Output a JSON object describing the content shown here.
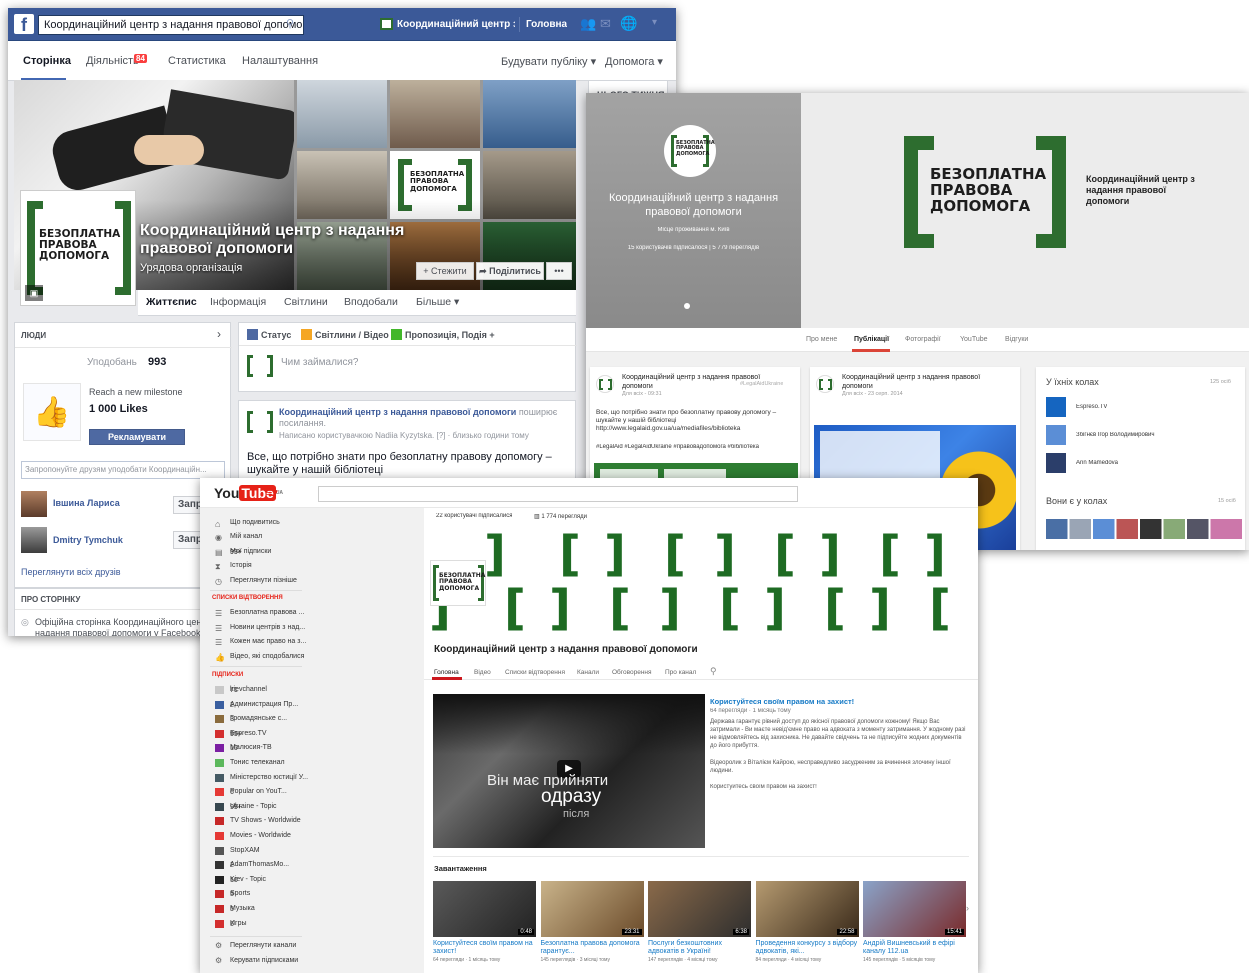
{
  "colors": {
    "fb_blue": "#3b5998",
    "brand_green": "#2d6d2f",
    "yt_red": "#e62117",
    "gp_link": "#4285f4"
  },
  "brand": {
    "logo_text": "БЕЗОПЛАТНА ПРАВОВА ДОПОМОГА"
  },
  "facebook": {
    "search_value": "Координаційний центр з надання правової допомоги",
    "top_page_name": "Координаційний центр з на...",
    "top_home": "Головна",
    "admin_tabs": [
      "Сторінка",
      "Діяльність",
      "Статистика",
      "Налаштування"
    ],
    "activity_badge": "84",
    "build_audience": "Будувати публіку ▾",
    "help": "Допомога ▾",
    "this_week": "ЦЬОГО ТИЖНЯ",
    "page_title": "Координаційний центр з надання правової допомоги",
    "page_category": "Урядова організація",
    "follow_btn": "+ Стежити",
    "share_btn": "Поділитись",
    "more_dots": "•••",
    "tabs": [
      "Життєпис",
      "Інформація",
      "Світлини",
      "Вподобали",
      "Більше ▾"
    ],
    "people_header": "ЛЮДИ",
    "likes_label": "Уподобань",
    "likes_count": "993",
    "milestone_caption": "Reach a new milestone",
    "milestone_value": "1 000 Likes",
    "promote_btn": "Рекламувати сторінку",
    "invite_placeholder": "Запропонуйте друзям уподобати Координаційн...",
    "friends": [
      {
        "name": "Івшина Лариса",
        "action": "Запро"
      },
      {
        "name": "Dmitry Tymchuk",
        "action": "Запро"
      }
    ],
    "see_all": "Переглянути всіх друзів",
    "about_header": "ПРО СТОРІНКУ",
    "about_text": "Офіційна сторінка Координаційного центру з надання правової допомоги у Facebook",
    "composer_tabs": [
      "Статус",
      "Світлини / Відео",
      "Пропозиція, Подія +"
    ],
    "composer_placeholder": "Чим займалися?",
    "post_author": "Координаційний центр з надання правової допомоги",
    "post_shared": "поширює посилання.",
    "post_meta": "Написано користувачкою Nadiia Kyzytska. [?] · близько години тому",
    "post_text": "Все, що потрібно знати про безоплатну правову допомогу – шукайте у нашій бібліотеці"
  },
  "gplus": {
    "name": "Координаційний центр з надання правової допомоги",
    "location": "Місце проживання м. Київ",
    "stats": "15 користувачів підписалося | 5 779 переглядів",
    "cover_caption": "Координаційний центр з надання правової допомоги",
    "tabs": [
      "Про мене",
      "Публікації",
      "Фотографії",
      "YouTube",
      "Відгуки"
    ],
    "post1": {
      "author": "Координаційний центр з надання правової допомоги",
      "meta": "Для всіх - 09:31",
      "tag": "#LegalAidUkraine",
      "text": "Все, що потрібно знати про безоплатну правову допомогу – шукайте у нашій бібліотеці",
      "link": "http://www.legalaid.gov.ua/ua/mediafiles/biblioteka",
      "hashtags": "#LegalAid #LegalAidUkraine #правовадопомога #бібліотека"
    },
    "post2": {
      "author": "Координаційний центр з надання правової допомоги",
      "meta": "Для всіх - 23 серп. 2014"
    },
    "circles_title": "У їхніх колах",
    "circles_count": "125 осіб",
    "circle_people": [
      "Espreso.TV",
      "Збігнєв Ігор Володимирович",
      "Ann Mamedova"
    ],
    "in_circles_title": "Вони є у колах",
    "in_circles_count": "15 осіб"
  },
  "youtube": {
    "logo_you": "You",
    "logo_tube": "Tube",
    "logo_country": "UA",
    "nav": [
      {
        "label": "Що подивитись",
        "icon": "home-icon"
      },
      {
        "label": "Мій канал",
        "icon": "user-icon"
      },
      {
        "label": "Мої підписки",
        "icon": "subscriptions-icon",
        "count": "99+"
      },
      {
        "label": "Історія",
        "icon": "history-icon"
      },
      {
        "label": "Переглянути пізніше",
        "icon": "clock-icon"
      }
    ],
    "playlists_header": "СПИСКИ ВІДТВОРЕННЯ",
    "playlists": [
      "Безоплатна правова ...",
      "Новини центрів з над...",
      "Кожен має право на з...",
      "Відео, які сподобалися"
    ],
    "subs_header": "ПІДПИСКИ",
    "subs": [
      {
        "name": "kievchannel",
        "count": "71"
      },
      {
        "name": "Администрация Пр...",
        "count": "2"
      },
      {
        "name": "Громадянське с...",
        "count": "3"
      },
      {
        "name": "Espreso.TV",
        "count": "99+"
      },
      {
        "name": "Малюсия-ТВ",
        "count": "10"
      },
      {
        "name": "Тонис телеканал",
        "count": ""
      },
      {
        "name": "Міністерство юстиції У...",
        "count": ""
      },
      {
        "name": "Popular on YouT...",
        "count": "6"
      },
      {
        "name": "Ukraine - Topic",
        "count": "99+"
      },
      {
        "name": "TV Shows - Worldwide",
        "count": ""
      },
      {
        "name": "Movies - Worldwide",
        "count": ""
      },
      {
        "name": "StopXAM",
        "count": ""
      },
      {
        "name": "AdamThomasMo...",
        "count": "2"
      },
      {
        "name": "Kiev - Topic",
        "count": "10"
      },
      {
        "name": "Sports",
        "count": "5"
      },
      {
        "name": "Музыка",
        "count": "5"
      },
      {
        "name": "Игры",
        "count": "5"
      }
    ],
    "browse_channels": "Переглянути канали",
    "manage_subs": "Керувати підписками",
    "banner_subs": "22 користувачі підписалися",
    "banner_views": "1 774 перегляди",
    "channel_name": "Координаційний центр з надання правової допомоги",
    "tabs": [
      "Головна",
      "Відео",
      "Списки відтворення",
      "Канали",
      "Обговорення",
      "Про канал"
    ],
    "featured_title": "Користуйтеся своїм правом на захист!",
    "featured_meta": "64 перегляди · 1 місяць тому",
    "featured_desc1": "Держава гарантує рівний доступ до якісної правової допомоги кожному! Якщо Вас затримали - Ви маєте невід'ємне право на адвоката з моменту затримання. У жодному разі не відмовляйтесь від захисника. Не давайте свідчень та не підписуйте жодних документів до його прибуття.",
    "featured_desc2": "Відеоролик з Віталієм Кайрою, несправедливо засудженим за вчинення злочину іншої людини.",
    "featured_desc3": "Користуйтесь своїм правом на захист!",
    "player_overlay1": "Він має прийняти",
    "player_overlay2": "одразу",
    "player_overlay3": "після",
    "uploads_header": "Завантаження",
    "uploads": [
      {
        "title": "Користуйтеся своїм правом на захист!",
        "meta": "64 перегляди · 1 місяць тому",
        "duration": "0:48"
      },
      {
        "title": "Безоплатна правова допомога гарантує...",
        "meta": "145 переглядів · 3 місяці тому",
        "duration": "23:31"
      },
      {
        "title": "Послуги безкоштовних адвокатів в Україні!",
        "meta": "147 переглядів · 4 місяці тому",
        "duration": "6:38"
      },
      {
        "title": "Проведення конкурсу з відбору адвокатів, які...",
        "meta": "84 перегляди · 4 місяці тому",
        "duration": "22:58"
      },
      {
        "title": "Андрій Вишневський в ефірі каналу 112.ua",
        "meta": "145 переглядів · 5 місяців тому",
        "duration": "15:41"
      }
    ]
  }
}
